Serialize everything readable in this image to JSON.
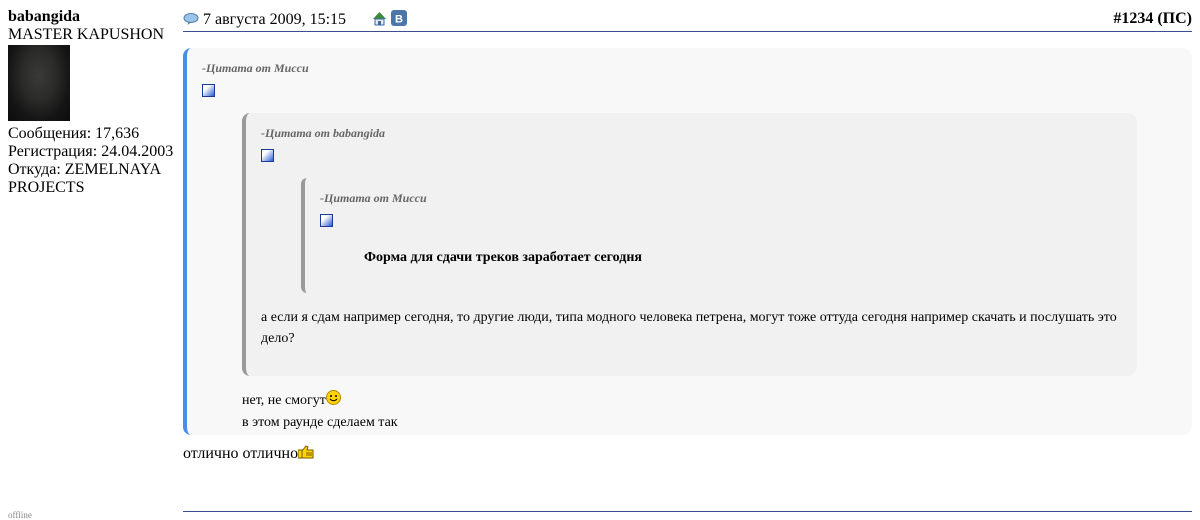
{
  "user": {
    "name": "babangida",
    "title": "MASTER KAPUSHON",
    "posts": "Сообщения: 17,636",
    "registered": "Регистрация: 24.04.2003",
    "from": "Откуда: ZEMELNAYA PROJECTS",
    "status": "offline"
  },
  "post": {
    "date": "7 августа 2009, 15:15",
    "number": "#1234",
    "tag": "ПС",
    "quote1": {
      "title": "-Цитата от Мисси",
      "quote2": {
        "title": "-Цитата от babangida",
        "quote3": {
          "title": "-Цитата от Мисси",
          "text": "Форма для сдачи треков заработает сегодня"
        },
        "text": "а если я сдам например сегодня, то другие люди, типа модного человека петрена, могут тоже оттуда сегодня например скачать и послушать это дело?"
      },
      "line1": "нет, не смогут",
      "line2": "в этом раунде сделаем так"
    },
    "text": "отлично отлично"
  }
}
